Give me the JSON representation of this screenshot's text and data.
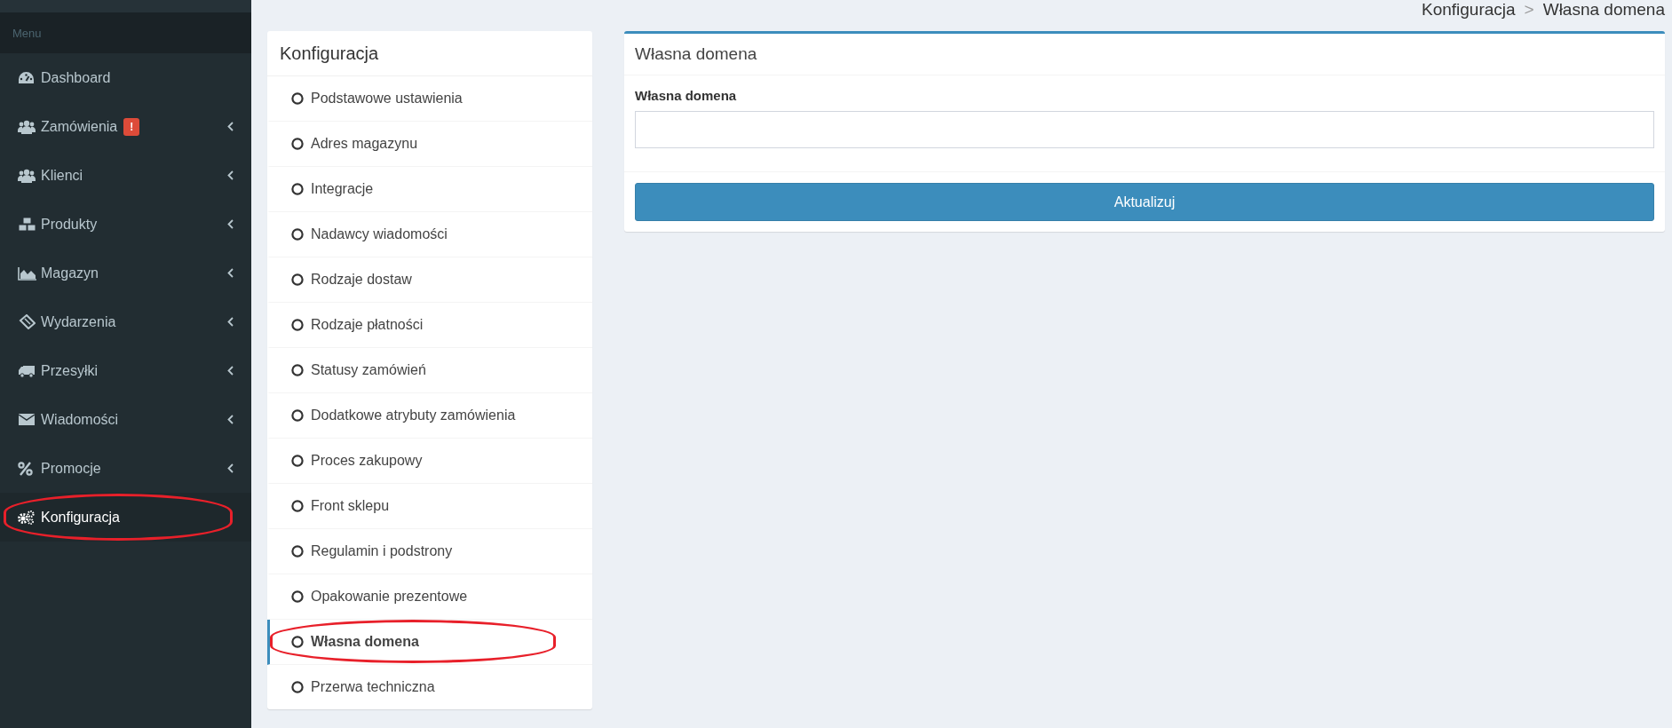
{
  "sidebar": {
    "header": "Menu",
    "items": [
      {
        "label": "Dashboard",
        "has_submenu": false,
        "selected": false,
        "circled": false
      },
      {
        "label": "Zamówienia",
        "badge": "!",
        "has_submenu": true,
        "selected": false,
        "circled": false
      },
      {
        "label": "Klienci",
        "has_submenu": true,
        "selected": false,
        "circled": false
      },
      {
        "label": "Produkty",
        "has_submenu": true,
        "selected": false,
        "circled": false
      },
      {
        "label": "Magazyn",
        "has_submenu": true,
        "selected": false,
        "circled": false
      },
      {
        "label": "Wydarzenia",
        "has_submenu": true,
        "selected": false,
        "circled": false
      },
      {
        "label": "Przesyłki",
        "has_submenu": true,
        "selected": false,
        "circled": false
      },
      {
        "label": "Wiadomości",
        "has_submenu": true,
        "selected": false,
        "circled": false
      },
      {
        "label": "Promocje",
        "has_submenu": true,
        "selected": false,
        "circled": false
      },
      {
        "label": "Konfiguracja",
        "has_submenu": false,
        "selected": true,
        "circled": true
      }
    ]
  },
  "breadcrumb": {
    "items": [
      "Konfiguracja",
      "Własna domena"
    ],
    "separator": ">"
  },
  "config_menu": {
    "title": "Konfiguracja",
    "items": [
      {
        "label": "Podstawowe ustawienia",
        "selected": false,
        "circled": false
      },
      {
        "label": "Adres magazynu",
        "selected": false,
        "circled": false
      },
      {
        "label": "Integracje",
        "selected": false,
        "circled": false
      },
      {
        "label": "Nadawcy wiadomości",
        "selected": false,
        "circled": false
      },
      {
        "label": "Rodzaje dostaw",
        "selected": false,
        "circled": false
      },
      {
        "label": "Rodzaje płatności",
        "selected": false,
        "circled": false
      },
      {
        "label": "Statusy zamówień",
        "selected": false,
        "circled": false
      },
      {
        "label": "Dodatkowe atrybuty zamówienia",
        "selected": false,
        "circled": false
      },
      {
        "label": "Proces zakupowy",
        "selected": false,
        "circled": false
      },
      {
        "label": "Front sklepu",
        "selected": false,
        "circled": false
      },
      {
        "label": "Regulamin i podstrony",
        "selected": false,
        "circled": false
      },
      {
        "label": "Opakowanie prezentowe",
        "selected": false,
        "circled": false
      },
      {
        "label": "Własna domena",
        "selected": true,
        "circled": true
      },
      {
        "label": "Przerwa techniczna",
        "selected": false,
        "circled": false
      }
    ]
  },
  "form": {
    "title": "Własna domena",
    "field_label": "Własna domena",
    "button": "Aktualizuj"
  }
}
